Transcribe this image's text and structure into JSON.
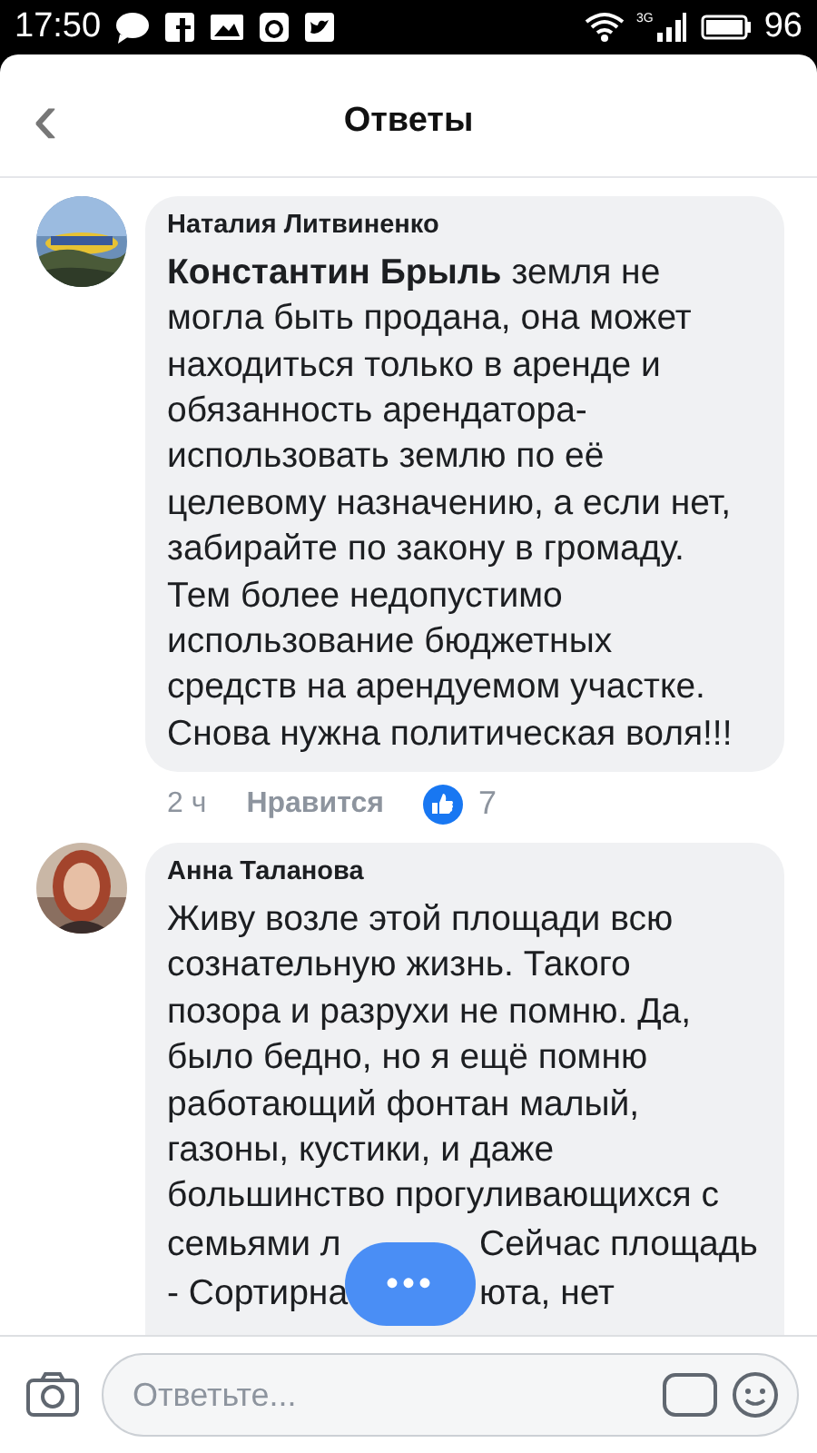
{
  "status_bar": {
    "time": "17:50",
    "network": "3G",
    "battery": "96"
  },
  "header": {
    "back": "‹",
    "title": "Ответы"
  },
  "comments": [
    {
      "author": "Наталия Литвиненко",
      "lines": [
        [
          "**Константин Брыль** земля не"
        ],
        [
          "могла быть продана, она может"
        ],
        [
          "находиться только в аренде и"
        ],
        [
          "обязанность арендатора-"
        ],
        [
          "использовать землю по её"
        ],
        [
          "целевому назначению, а если нет,"
        ],
        [
          "забирайте по закону в громаду."
        ],
        [
          "Тем более недопустимо"
        ],
        [
          "использование бюджетных"
        ],
        [
          "средств на арендуемом участке."
        ],
        [
          "Снова нужна политическая воля!!!"
        ]
      ],
      "time": "2 ч",
      "like_label": "Нравится",
      "likes": "7"
    },
    {
      "author": "Анна Таланова",
      "lines": [
        [
          "Живу возле этой площади всю"
        ],
        [
          "сознательную жизнь. Такого"
        ],
        [
          "позора и разрухи не помню. Да,"
        ],
        [
          "было бедно, но я ещё помню"
        ],
        [
          "работающий фонтан малый,"
        ],
        [
          "газоны, кустики, и даже"
        ],
        [
          "большинство прогуливающихся с"
        ],
        [
          "семьями л",
          "Сейчас площадь"
        ],
        [
          "- Сортирна",
          "юта, нет"
        ]
      ]
    }
  ],
  "more_button": "•••",
  "composer": {
    "placeholder": "Ответьте..."
  }
}
